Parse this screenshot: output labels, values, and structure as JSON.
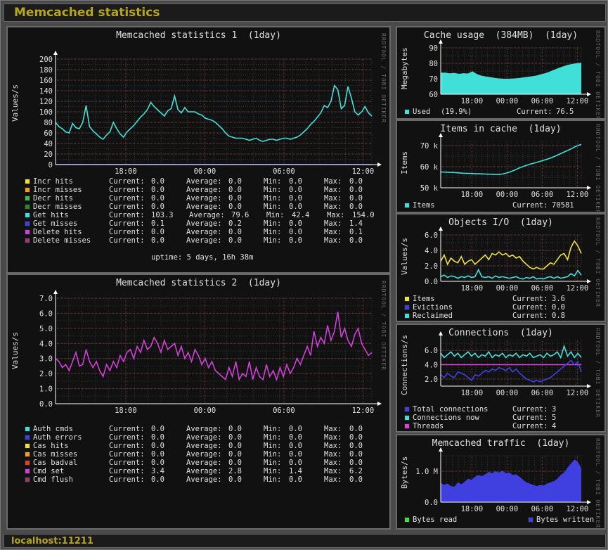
{
  "app": {
    "title": "Memcached statistics",
    "host": "localhost:11211"
  },
  "colors": {
    "background": "#111111",
    "grid": "#3a3a3a",
    "gold": "#b5a51f"
  },
  "axis_tag": "RRDTOOL / TOBI OETIKER",
  "panels": {
    "stats1": {
      "title": "Memcached statistics 1  (1day)",
      "ylabel": "Values/s",
      "uptime": "uptime: 5 days, 16h 38m",
      "legend": [
        {
          "name": "Incr hits",
          "color": "#f0e040",
          "current": "0.0",
          "average": "0.0",
          "min": "0.0",
          "max": "0.0"
        },
        {
          "name": "Incr misses",
          "color": "#f0a020",
          "current": "0.0",
          "average": "0.0",
          "min": "0.0",
          "max": "0.0"
        },
        {
          "name": "Decr hits",
          "color": "#40c040",
          "current": "0.0",
          "average": "0.0",
          "min": "0.0",
          "max": "0.0"
        },
        {
          "name": "Decr misses",
          "color": "#308030",
          "current": "0.0",
          "average": "0.0",
          "min": "0.0",
          "max": "0.0"
        },
        {
          "name": "Get hits",
          "color": "#40e0d8",
          "current": "103.3",
          "average": "79.6",
          "min": "42.4",
          "max": "154.0"
        },
        {
          "name": "Get misses",
          "color": "#4040e0",
          "current": "0.1",
          "average": "0.2",
          "min": "0.0",
          "max": "1.4"
        },
        {
          "name": "Delete hits",
          "color": "#d040d8",
          "current": "0.0",
          "average": "0.0",
          "min": "0.0",
          "max": "0.1"
        },
        {
          "name": "Delete misses",
          "color": "#904070",
          "current": "0.0",
          "average": "0.0",
          "min": "0.0",
          "max": "0.0"
        }
      ]
    },
    "stats2": {
      "title": "Memcached statistics 2  (1day)",
      "ylabel": "Values/s",
      "legend": [
        {
          "name": "Auth cmds",
          "color": "#40e0d8",
          "current": "0.0",
          "average": "0.0",
          "min": "0.0",
          "max": "0.0"
        },
        {
          "name": "Auth errors",
          "color": "#4040e0",
          "current": "0.0",
          "average": "0.0",
          "min": "0.0",
          "max": "0.0"
        },
        {
          "name": "Cas hits",
          "color": "#f0e040",
          "current": "0.0",
          "average": "0.0",
          "min": "0.0",
          "max": "0.0"
        },
        {
          "name": "Cas misses",
          "color": "#f0a020",
          "current": "0.0",
          "average": "0.0",
          "min": "0.0",
          "max": "0.0"
        },
        {
          "name": "Cas badval",
          "color": "#e04020",
          "current": "0.0",
          "average": "0.0",
          "min": "0.0",
          "max": "0.0"
        },
        {
          "name": "Cmd set",
          "color": "#d040d8",
          "current": "3.4",
          "average": "2.8",
          "min": "1.4",
          "max": "6.2"
        },
        {
          "name": "Cmd flush",
          "color": "#904070",
          "current": "0.0",
          "average": "0.0",
          "min": "0.0",
          "max": "0.0"
        }
      ]
    },
    "cache": {
      "title": "Cache usage  (384MB)  (1day)",
      "ylabel": "Megabytes",
      "legend": [
        {
          "name": "Used",
          "extra": "(19.9%)",
          "color": "#40e0d8",
          "current": "76.5"
        }
      ]
    },
    "items": {
      "title": "Items in cache  (1day)",
      "ylabel": "Items",
      "legend": [
        {
          "name": "Items",
          "color": "#40e0d8",
          "current": "70581"
        }
      ]
    },
    "objects": {
      "title": "Objects I/O  (1day)",
      "ylabel": "Values/s",
      "legend": [
        {
          "name": "Items",
          "color": "#f0e040",
          "current": "3.6"
        },
        {
          "name": "Evictions",
          "color": "#4040e0",
          "current": "0.0"
        },
        {
          "name": "Reclaimed",
          "color": "#40e0d8",
          "current": "0.8"
        }
      ]
    },
    "connections": {
      "title": "Connections  (1day)",
      "ylabel": "Connections/s",
      "legend": [
        {
          "name": "Total connections",
          "color": "#4040e0",
          "current": "3"
        },
        {
          "name": "Connections now",
          "color": "#40e0d8",
          "current": "5"
        },
        {
          "name": "Threads",
          "color": "#e040e0",
          "current": "4"
        }
      ]
    },
    "traffic": {
      "title": "Memcached traffic  (1day)",
      "ylabel": "Bytes/s",
      "legend": [
        {
          "name": "Bytes read",
          "color": "#40e040"
        },
        {
          "name": "Bytes written",
          "color": "#4040e0"
        }
      ]
    }
  },
  "labels": {
    "current": "Current:",
    "average": "Average:",
    "min": "Min:",
    "max": "Max:"
  },
  "chart_data": [
    {
      "id": "stats1",
      "type": "line",
      "ylim": [
        0,
        200
      ],
      "yticks": [
        0,
        20,
        40,
        60,
        80,
        100,
        120,
        140,
        160,
        180,
        200
      ],
      "xticks": [
        "18:00",
        "00:00",
        "06:00",
        "12:00"
      ],
      "series": [
        {
          "name": "Get hits",
          "color": "#40e0d8",
          "values": [
            80,
            72,
            68,
            62,
            60,
            78,
            70,
            68,
            80,
            112,
            72,
            64,
            58,
            52,
            48,
            56,
            62,
            80,
            68,
            58,
            52,
            62,
            68,
            74,
            82,
            90,
            96,
            104,
            118,
            110,
            104,
            98,
            92,
            102,
            106,
            130,
            104,
            98,
            108,
            100,
            100,
            100,
            96,
            94,
            88,
            86,
            84,
            80,
            74,
            68,
            60,
            54,
            52,
            50,
            50,
            50,
            48,
            46,
            48,
            50,
            46,
            44,
            46,
            48,
            48,
            46,
            48,
            50,
            50,
            48,
            50,
            52,
            56,
            62,
            68,
            76,
            82,
            90,
            98,
            112,
            108,
            120,
            150,
            142,
            106,
            112,
            148,
            126,
            100,
            94,
            100,
            110,
            98,
            92
          ]
        },
        {
          "name": "Get misses",
          "color": "#4040e0",
          "values": [
            0.1,
            0.2,
            0.1,
            0.2,
            0.1,
            0.2,
            0.2,
            0.1,
            0.2,
            0.2,
            0.1,
            0.2,
            0.3,
            0.2,
            0.1,
            0.2,
            0.2,
            0.1
          ]
        }
      ]
    },
    {
      "id": "stats2",
      "type": "line",
      "ylim": [
        0,
        7
      ],
      "yticks": [
        0,
        1,
        2,
        3,
        4,
        5,
        6,
        7
      ],
      "xticks": [
        "18:00",
        "00:00",
        "06:00",
        "12:00"
      ],
      "series": [
        {
          "name": "Cmd set",
          "color": "#d040d8",
          "values": [
            3.0,
            2.8,
            2.4,
            2.6,
            2.2,
            2.8,
            3.4,
            2.5,
            2.6,
            3.6,
            2.8,
            2.4,
            2.8,
            2.2,
            1.8,
            2.6,
            2.2,
            2.8,
            2.4,
            3.2,
            2.8,
            3.4,
            3.6,
            3.0,
            3.8,
            3.4,
            4.2,
            3.6,
            3.8,
            4.4,
            4.0,
            3.4,
            4.2,
            3.6,
            3.8,
            4.0,
            3.2,
            3.8,
            3.0,
            3.4,
            2.8,
            3.6,
            3.2,
            2.6,
            3.0,
            2.4,
            2.8,
            2.2,
            2.0,
            1.8,
            1.6,
            2.4,
            1.8,
            2.8,
            1.6,
            2.0,
            1.8,
            2.8,
            1.6,
            2.4,
            1.8,
            1.6,
            2.6,
            1.8,
            2.2,
            1.6,
            2.4,
            1.8,
            2.6,
            2.0,
            2.4,
            3.0,
            2.6,
            3.2,
            3.8,
            3.2,
            4.8,
            3.8,
            4.4,
            4.0,
            5.2,
            4.2,
            4.8,
            6.1,
            4.4,
            5.0,
            4.2,
            3.8,
            4.6,
            5.0,
            4.0,
            3.6,
            3.2,
            3.4
          ]
        }
      ]
    },
    {
      "id": "cache",
      "type": "area",
      "ylim": [
        60,
        90
      ],
      "yticks": [
        60,
        70,
        80,
        90
      ],
      "xticks": [
        "18:00",
        "00:00",
        "06:00",
        "12:00"
      ],
      "series": [
        {
          "name": "Used",
          "color": "#40e0d8",
          "values": [
            74,
            74,
            73.5,
            73.8,
            73.2,
            73.6,
            73.4,
            74.8,
            73,
            72,
            71.5,
            71,
            70.5,
            70.2,
            70,
            70,
            70.2,
            70.4,
            70.8,
            71.2,
            71.6,
            72,
            72.8,
            73.6,
            74.6,
            75.8,
            77,
            78,
            79,
            79.6,
            80,
            80.4
          ]
        }
      ]
    },
    {
      "id": "items",
      "type": "line",
      "ylim": [
        50000,
        72000
      ],
      "yticks": [
        50000,
        60000,
        70000
      ],
      "xticklabels": [
        "50 k",
        "60 k",
        "70 k"
      ],
      "xticks": [
        "18:00",
        "00:00",
        "06:00",
        "12:00"
      ],
      "series": [
        {
          "name": "Items",
          "color": "#40e0d8",
          "values": [
            57500,
            57400,
            57300,
            57100,
            56900,
            56800,
            56700,
            56600,
            56500,
            56400,
            56300,
            56500,
            57200,
            58200,
            59400,
            60400,
            61300,
            62000,
            62800,
            63600,
            64600,
            65800,
            67000,
            68200,
            69600,
            70600
          ]
        }
      ]
    },
    {
      "id": "objects",
      "type": "line",
      "ylim": [
        0,
        6
      ],
      "yticks": [
        0,
        2,
        4,
        6
      ],
      "xticks": [
        "18:00",
        "00:00",
        "06:00",
        "12:00"
      ],
      "series": [
        {
          "name": "Items",
          "color": "#f0e040",
          "values": [
            2.6,
            3.4,
            2.2,
            3.0,
            2.6,
            2.4,
            3.2,
            2.2,
            2.6,
            2.8,
            2.2,
            2.6,
            3.0,
            3.4,
            2.8,
            3.6,
            3.4,
            3.8,
            3.4,
            3.6,
            3.2,
            3.4,
            3.0,
            3.2,
            2.6,
            2.2,
            1.8,
            1.6,
            1.8,
            1.6,
            1.6,
            2.0,
            2.4,
            2.2,
            2.8,
            3.4,
            3.6,
            2.8,
            4.4,
            5.2,
            4.6,
            3.6
          ]
        },
        {
          "name": "Reclaimed",
          "color": "#40e0d8",
          "values": [
            0.6,
            0.8,
            0.5,
            0.7,
            0.6,
            0.4,
            0.6,
            0.5,
            0.7,
            0.5,
            0.6,
            1.5,
            0.6,
            0.5,
            0.6,
            0.4,
            0.7,
            0.5,
            0.6,
            0.5,
            0.4,
            0.5,
            0.6,
            0.4,
            0.3,
            0.5,
            0.4,
            0.6,
            0.3,
            0.4,
            0.3,
            0.5,
            0.6,
            0.4,
            0.6,
            0.4,
            0.5,
            0.6,
            1.0,
            0.7,
            1.4,
            0.8
          ]
        }
      ]
    },
    {
      "id": "connections",
      "type": "line",
      "ylim": [
        1,
        7.5
      ],
      "yticks": [
        2,
        4,
        6
      ],
      "xticks": [
        "18:00",
        "00:00",
        "06:00",
        "12:00"
      ],
      "series": [
        {
          "name": "Connections now",
          "color": "#40e0d8",
          "values": [
            5.6,
            5.0,
            5.4,
            5.8,
            5.2,
            5.6,
            5.0,
            5.4,
            5.8,
            5.2,
            5.6,
            5.0,
            5.4,
            5.2,
            5.8,
            5.0,
            5.4,
            5.2,
            5.6,
            5.0,
            5.4,
            5.2,
            5.6,
            5.0,
            5.4,
            5.2,
            5.6,
            5.0,
            5.2,
            5.4,
            5.0,
            5.6,
            5.2,
            5.4,
            5.8,
            5.0,
            6.6,
            5.2,
            5.8,
            5.0,
            5.6,
            5.0
          ]
        },
        {
          "name": "Threads",
          "color": "#e040e0",
          "values": [
            4,
            4,
            4,
            4,
            4,
            4,
            4,
            4,
            4,
            4,
            4,
            4,
            4,
            4,
            4,
            4,
            4,
            4,
            4,
            4,
            4,
            4,
            4,
            4,
            4,
            4,
            4,
            4,
            4,
            4,
            4,
            4,
            4,
            4,
            4,
            4,
            4,
            4,
            4,
            4,
            4,
            4
          ]
        },
        {
          "name": "Total connections",
          "color": "#4040e0",
          "values": [
            2.6,
            2.2,
            2.8,
            2.4,
            2.2,
            3.0,
            2.8,
            2.6,
            2.2,
            1.8,
            2.6,
            2.4,
            2.8,
            3.2,
            3.0,
            3.4,
            3.2,
            3.6,
            3.4,
            3.2,
            3.6,
            3.0,
            3.4,
            2.8,
            2.4,
            2.0,
            1.8,
            1.6,
            1.8,
            1.6,
            1.8,
            2.0,
            2.2,
            2.6,
            3.0,
            3.4,
            3.8,
            4.2,
            4.6,
            4.0,
            4.4,
            3.0
          ]
        }
      ]
    },
    {
      "id": "traffic",
      "type": "area",
      "ylim": [
        0,
        1500000
      ],
      "yticks": [
        0,
        1000000
      ],
      "yticklabels": [
        "0.0",
        "1.0 M"
      ],
      "xticks": [
        "18:00",
        "00:00",
        "06:00",
        "12:00"
      ],
      "series": [
        {
          "name": "Bytes written",
          "color": "#4040e0",
          "values": [
            620000,
            560000,
            600000,
            520000,
            500000,
            640000,
            580000,
            660000,
            760000,
            720000,
            820000,
            880000,
            840000,
            900000,
            980000,
            940000,
            1000000,
            960000,
            1020000,
            940000,
            960000,
            880000,
            900000,
            820000,
            720000,
            640000,
            600000,
            560000,
            520000,
            560000,
            540000,
            600000,
            640000,
            680000,
            760000,
            880000,
            960000,
            1120000,
            1250000,
            1380000,
            1300000,
            1100000
          ]
        },
        {
          "name": "Bytes read",
          "color": "#40e040",
          "values": [
            0,
            0,
            0,
            0,
            0,
            0,
            0,
            0,
            0,
            0
          ]
        }
      ]
    }
  ]
}
